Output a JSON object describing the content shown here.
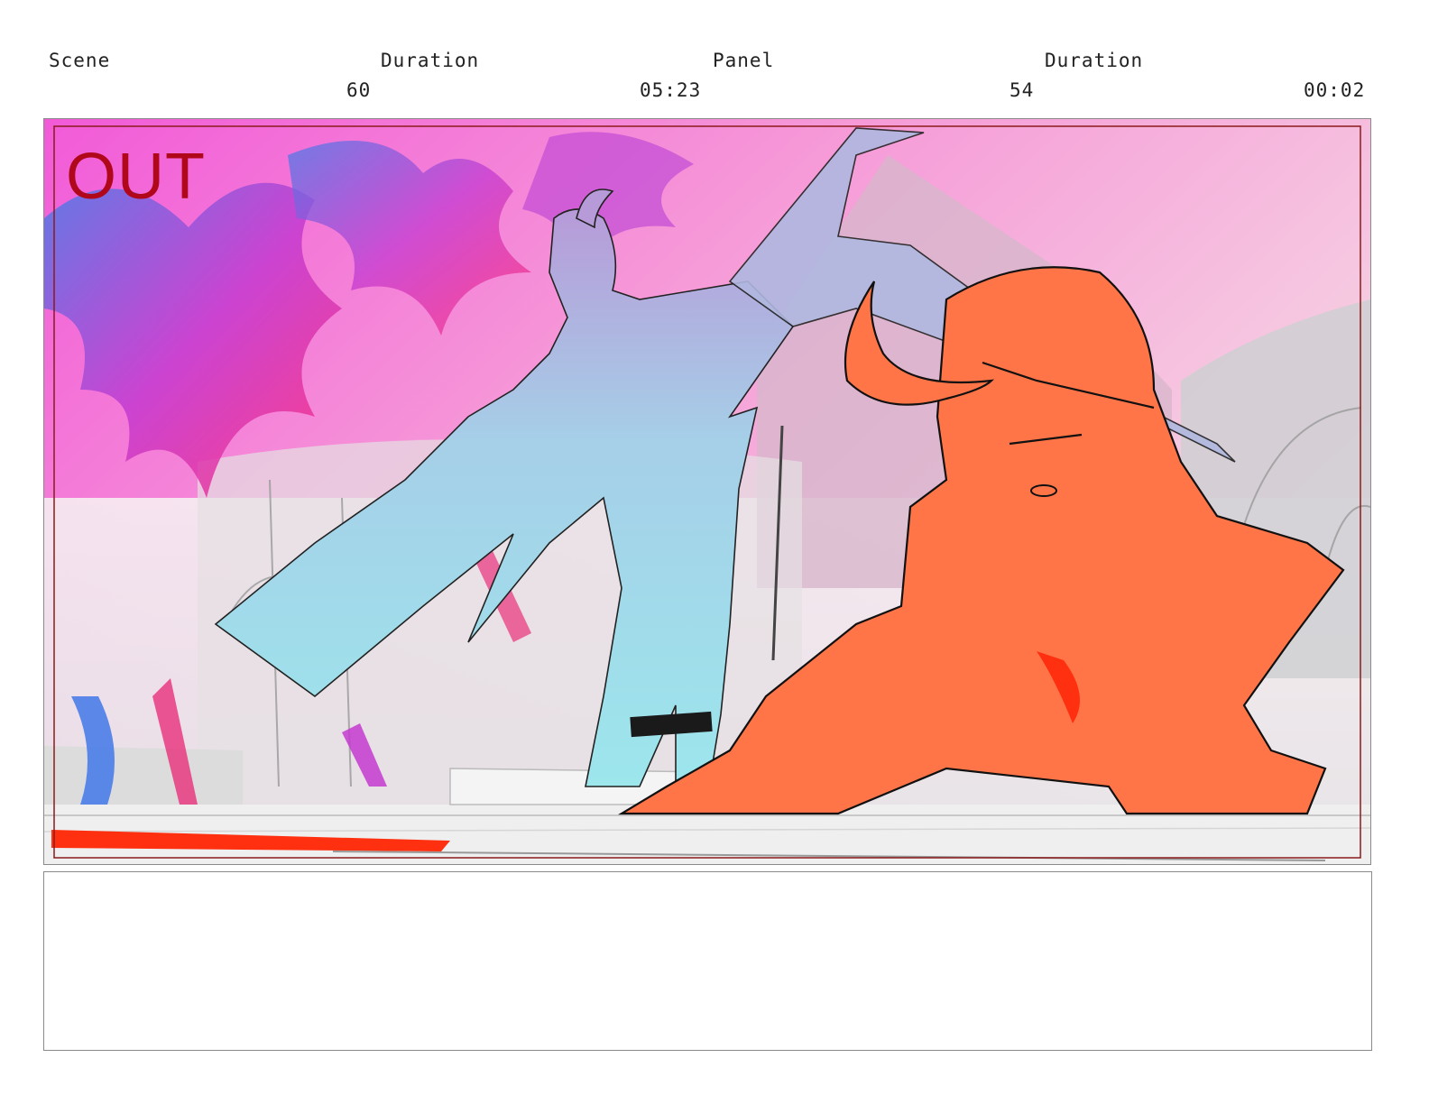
{
  "header": {
    "scene_label": "Scene",
    "scene_duration_label": "Duration",
    "panel_label": "Panel",
    "panel_duration_label": "Duration",
    "scene_value": "60",
    "scene_duration_value": "05:23",
    "panel_value": "54",
    "panel_duration_value": "00:02"
  },
  "panel": {
    "overlay_text": "OUT",
    "overlay_color": "#b0081a",
    "safe_frame_color": "#8b1a1a"
  },
  "notes": {
    "text": ""
  },
  "colors": {
    "sky_top": "#f060d0",
    "character_left": "#9fe3ec",
    "character_right": "#ff7548",
    "accent_red": "#ff3010"
  }
}
